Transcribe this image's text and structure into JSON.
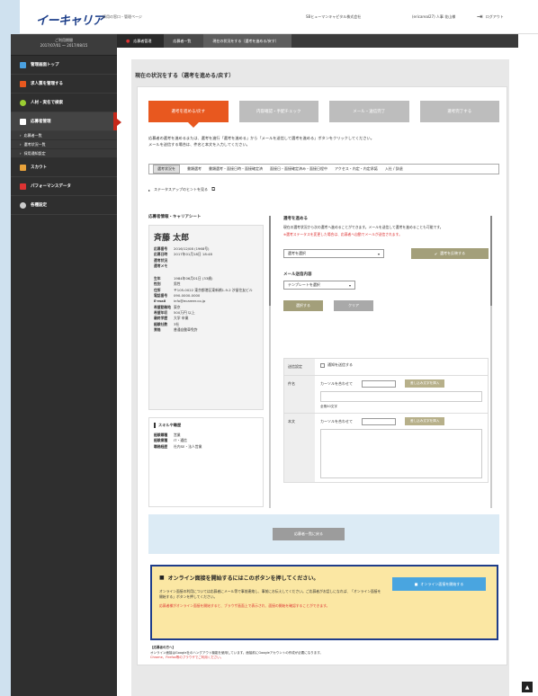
{
  "header": {
    "logo": "イーキャリア",
    "logo_sub": "採用の窓口・管理ページ",
    "company": "SBヒューマンキャピタル株式会社",
    "user": "(ericareal27) 人事 花山様",
    "logout": "ログアウト"
  },
  "sidebar": {
    "date_label": "ご利用期間",
    "date_range": "2017/07/01 〜 2017/08/15",
    "items": [
      {
        "label": "管理画面トップ",
        "icon_color": "#4aa0e0"
      },
      {
        "label": "求人票を管理する",
        "icon_color": "#e8581f"
      },
      {
        "label": "人材・実名で検索",
        "icon_color": "#9acd32"
      },
      {
        "label": "応募者管理",
        "icon_color": "#ffffff"
      },
      {
        "label": "スカウト",
        "icon_color": "#e8a23b"
      },
      {
        "label": "パフォーマンスデータ",
        "icon_color": "#d33"
      },
      {
        "label": "各種設定",
        "icon_color": "#ccc"
      }
    ],
    "subitems": [
      "応募者一覧",
      "選考状況一覧",
      "採用通知設定"
    ]
  },
  "breadcrumbs": [
    "応募者管理",
    "応募者一覧",
    "現在の状況をする（選考を進める/戻す）"
  ],
  "page_title": "現在の状況をする（選考を進める/戻す）",
  "steps": [
    "選考を進める/戻す",
    "内容確認・手配チェック",
    "メール・送信完了",
    "選考完了する"
  ],
  "intro": [
    "応募者の選考を進めるまたは、選考を進行「選考を進める」から「メールを送信して選考を進める」ボタンをクリックしてください。",
    "メールを送信する場合は、件名と本文を入力してください。"
  ],
  "filterbar": {
    "selected": "選考状況を",
    "items": [
      "書類選考",
      "書類選考・面接日時・面接確定済",
      "面接日・面接確定済み・面接日程中",
      "アクセス・内定・内定承諾",
      "入社 / 辞退"
    ]
  },
  "tips": "ステータスアップのヒントを見る",
  "left": {
    "title": "応募者情報・キャリアシート",
    "name": "斉藤 太郎",
    "rows": [
      {
        "k": "応募番号",
        "v": "2016/12/08 (1968号)"
      },
      {
        "k": "応募日時",
        "v": "2017年01月18日 18:48"
      },
      {
        "k": "選考状況",
        "v": ""
      },
      {
        "k": "選考メモ",
        "v": ""
      }
    ],
    "rows2": [
      {
        "k": "生年",
        "v": "1984年06月01日 (33歳)"
      },
      {
        "k": "性別",
        "v": "男性"
      },
      {
        "k": "住所",
        "v": "〒105-0022 東京都港区東新橋1-9-2 汐留住友ビル"
      },
      {
        "k": "電話番号",
        "v": "090-0000-0000"
      },
      {
        "k": "E-mail",
        "v": "info@ecareer.co.jp"
      },
      {
        "k": "希望勤務地",
        "v": "東京"
      },
      {
        "k": "希望年収",
        "v": "500万円 以上"
      },
      {
        "k": "最終学歴",
        "v": "大学 卒業"
      },
      {
        "k": "経験社数",
        "v": "3社"
      },
      {
        "k": "資格",
        "v": "普通自動車免許"
      }
    ],
    "box2_title": "スキルや職歴",
    "rows3": [
      {
        "k": "経験職種",
        "v": "営業"
      },
      {
        "k": "経験業種",
        "v": "IT・通信"
      },
      {
        "k": "職務経歴",
        "v": "社内SE・法人営業"
      }
    ]
  },
  "right": {
    "title": "選考を進める",
    "desc": "現在の選考状況から次の選考へ進めることができます。メールを送信して選考を進めることも可能です。",
    "red": "※選考ステータスを変更した場合は、応募者へ自動でメールが送信されます。",
    "select_value": "選考を選択",
    "apply_btn": "選考を反映する",
    "template_title": "メール送信内容",
    "template_select": "テンプレートを選択",
    "btn_use": "選択する",
    "btn_clear": "クリア",
    "table": {
      "row1_label": "送信設定",
      "row1_text": "通知を送信する",
      "row2_label": "件名",
      "row2_text": "カーソルを合わせて",
      "row2_btn": "差し込み文字を挿入",
      "row2_note": "全角50文字",
      "row3_label": "本文",
      "row3_text": "カーソルを合わせて",
      "row3_btn": "差し込み文字を挿入"
    }
  },
  "confirm_btn": "応募者一覧に戻る",
  "notice": {
    "title": "オンライン面接を開始するにはこのボタンを押してください。",
    "text": "オンライン面接の利用については応募者にメール等で事前連絡し、事前にお伝えしてください。ご応募者がお話しになれば、「オンライン面接を開始する」ボタンを押してください。",
    "red": "応募者様がオンライン面接を開始すると、ブラウザ画面上で表示され、面接の開始を確認することができます。",
    "button": "オンライン面接を開始する"
  },
  "footnote": {
    "head": "【応募者の方へ】",
    "text": "オンライン面接はGoogle社のハングアウト機能を使用しています。面接前にGoogleアカウントの作成が必要になります。",
    "red": "Chrome、Firefox等のブラウザでご利用ください。"
  },
  "pagetop": "▲"
}
